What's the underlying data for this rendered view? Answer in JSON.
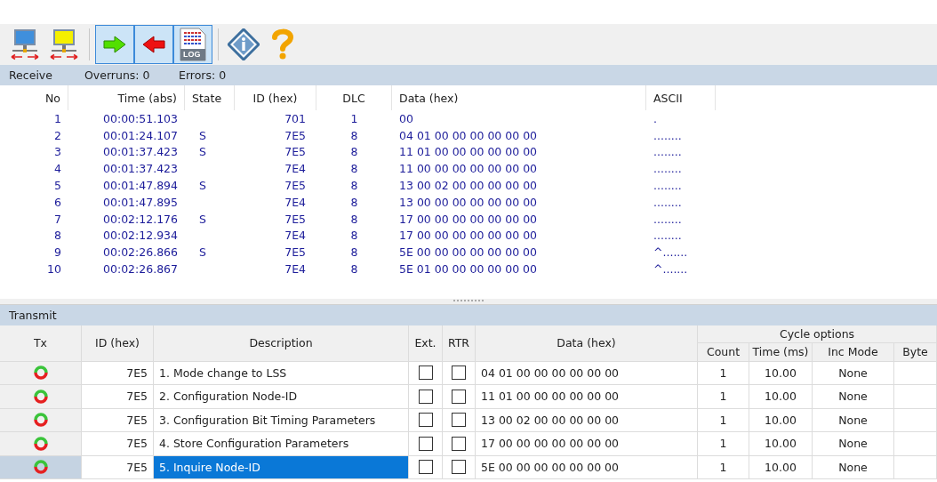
{
  "toolbar": {
    "items": [
      {
        "kind": "net-blue",
        "pressed": false
      },
      {
        "kind": "net-yellow",
        "pressed": false
      },
      {
        "kind": "separator"
      },
      {
        "kind": "arrow-right",
        "pressed": true
      },
      {
        "kind": "arrow-left",
        "pressed": true
      },
      {
        "kind": "log",
        "pressed": true,
        "label": "LOG"
      },
      {
        "kind": "separator"
      },
      {
        "kind": "info",
        "pressed": false
      },
      {
        "kind": "help",
        "pressed": false
      }
    ]
  },
  "receive": {
    "title": "Receive",
    "overruns": "Overruns: 0",
    "errors": "Errors: 0",
    "columns": [
      "No",
      "Time (abs)",
      "State",
      "ID (hex)",
      "DLC",
      "Data (hex)",
      "ASCII"
    ],
    "rows": [
      {
        "no": "1",
        "time": "00:00:51.103",
        "id": "701",
        "dlc": "1",
        "data": "00",
        "ascii": "."
      },
      {
        "no": "2",
        "time": "00:01:24.107",
        "state": "S",
        "id": "7E5",
        "dlc": "8",
        "data": "04 01 00 00 00 00 00 00",
        "ascii": "........"
      },
      {
        "no": "3",
        "time": "00:01:37.423",
        "state": "S",
        "id": "7E5",
        "dlc": "8",
        "data": "11 01 00 00 00 00 00 00",
        "ascii": "........"
      },
      {
        "no": "4",
        "time": "00:01:37.423",
        "id": "7E4",
        "dlc": "8",
        "data": "11 00 00 00 00 00 00 00",
        "ascii": "........"
      },
      {
        "no": "5",
        "time": "00:01:47.894",
        "state": "S",
        "id": "7E5",
        "dlc": "8",
        "data": "13 00 02 00 00 00 00 00",
        "ascii": "........"
      },
      {
        "no": "6",
        "time": "00:01:47.895",
        "id": "7E4",
        "dlc": "8",
        "data": "13 00 00 00 00 00 00 00",
        "ascii": "........"
      },
      {
        "no": "7",
        "time": "00:02:12.176",
        "state": "S",
        "id": "7E5",
        "dlc": "8",
        "data": "17 00 00 00 00 00 00 00",
        "ascii": "........"
      },
      {
        "no": "8",
        "time": "00:02:12.934",
        "id": "7E4",
        "dlc": "8",
        "data": "17 00 00 00 00 00 00 00",
        "ascii": "........"
      },
      {
        "no": "9",
        "time": "00:02:26.866",
        "state": "S",
        "id": "7E5",
        "dlc": "8",
        "data": "5E 00 00 00 00 00 00 00",
        "ascii": "^......."
      },
      {
        "no": "10",
        "time": "00:02:26.867",
        "id": "7E4",
        "dlc": "8",
        "data": "5E 01 00 00 00 00 00 00",
        "ascii": "^......."
      }
    ]
  },
  "transmit": {
    "title": "Transmit",
    "columns": [
      "Tx",
      "ID (hex)",
      "Description",
      "Ext.",
      "RTR",
      "Data (hex)"
    ],
    "cycle_group": "Cycle options",
    "cycle_columns": [
      "Count",
      "Time (ms)",
      "Inc Mode",
      "Byte"
    ],
    "rows": [
      {
        "id": "7E5",
        "description": "1. Mode change to LSS",
        "ext": false,
        "rtr": false,
        "data": "04 01 00 00 00 00 00 00",
        "count": "1",
        "time": "10.00",
        "inc_mode": "None",
        "selected": false
      },
      {
        "id": "7E5",
        "description": "2. Configuration Node-ID",
        "ext": false,
        "rtr": false,
        "data": "11 01 00 00 00 00 00 00",
        "count": "1",
        "time": "10.00",
        "inc_mode": "None",
        "selected": false
      },
      {
        "id": "7E5",
        "description": "3. Configuration Bit Timing Parameters",
        "ext": false,
        "rtr": false,
        "data": "13 00 02 00 00 00 00 00",
        "count": "1",
        "time": "10.00",
        "inc_mode": "None",
        "selected": false
      },
      {
        "id": "7E5",
        "description": "4. Store Configuration Parameters",
        "ext": false,
        "rtr": false,
        "data": "17 00 00 00 00 00 00 00",
        "count": "1",
        "time": "10.00",
        "inc_mode": "None",
        "selected": false
      },
      {
        "id": "7E5",
        "description": "5. Inquire Node-ID",
        "ext": false,
        "rtr": false,
        "data": "5E 00 00 00 00 00 00 00",
        "count": "1",
        "time": "10.00",
        "inc_mode": "None",
        "selected": true
      }
    ]
  }
}
